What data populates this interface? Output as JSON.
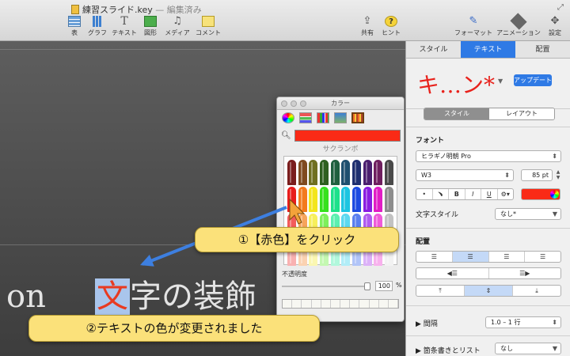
{
  "window": {
    "title": "練習スライド.key",
    "edited": "— 編集済み"
  },
  "toolbar": {
    "left_items": [
      {
        "label": "表",
        "icon": "table-icon"
      },
      {
        "label": "グラフ",
        "icon": "chart-icon"
      },
      {
        "label": "テキスト",
        "icon": "text-icon"
      },
      {
        "label": "図形",
        "icon": "shape-icon"
      },
      {
        "label": "メディア",
        "icon": "media-icon"
      },
      {
        "label": "コメント",
        "icon": "comment-icon"
      }
    ],
    "mid_items": [
      {
        "label": "共有",
        "icon": "share-icon"
      },
      {
        "label": "ヒント",
        "icon": "hint-icon"
      }
    ],
    "right_items": [
      {
        "label": "フォーマット",
        "icon": "format-icon"
      },
      {
        "label": "アニメーション",
        "icon": "animation-icon"
      },
      {
        "label": "設定",
        "icon": "settings-icon"
      }
    ]
  },
  "slide": {
    "word1": "on",
    "selected_char": "文",
    "rest": "字の装飾"
  },
  "colors_panel": {
    "title": "カラー",
    "current_color": "#fa2a16",
    "color_name": "サクランボ",
    "opacity_label": "不透明度",
    "opacity_value": "100",
    "opacity_unit": "%",
    "crayon_rows": [
      [
        "#7a1d1d",
        "#7f4a1f",
        "#6f6f21",
        "#2e5f1f",
        "#1f5f3f",
        "#1f4f6f",
        "#1f2f6f",
        "#4a1f6f",
        "#6f1f5f",
        "#4a4a4a"
      ],
      [
        "#e81c1c",
        "#f37a1d",
        "#f3e51d",
        "#36e11d",
        "#1de18a",
        "#1dc5e1",
        "#1d4ae1",
        "#8a1de1",
        "#e11dc5",
        "#8d8d8d"
      ],
      [
        "#f35b5b",
        "#f7a45b",
        "#f7ef5b",
        "#7ef05b",
        "#5bf0b0",
        "#5bd9f0",
        "#5b7ff0",
        "#b05bf0",
        "#f05bd9",
        "#c2c2c2"
      ],
      [
        "#f9b1b1",
        "#fbd2b1",
        "#fbf7b1",
        "#c4f8b1",
        "#b1f8dc",
        "#b1edf8",
        "#b1c4f8",
        "#dcb1f8",
        "#f8b1ed",
        "#f2f2f2"
      ]
    ]
  },
  "inspector": {
    "tabs": [
      "スタイル",
      "テキスト",
      "配置"
    ],
    "style_name": "キ…ン*",
    "update_label": "アップデート",
    "sub_tabs": [
      "スタイル",
      "レイアウト"
    ],
    "font_label": "フォント",
    "font_family": "ヒラギノ明朝 Pro",
    "font_weight": "W3",
    "font_size": "85 pt",
    "format_buttons": [
      "•",
      "﹅",
      "B",
      "I",
      "U",
      "⚙▾"
    ],
    "text_color": "#fa2a16",
    "char_style_label": "文字スタイル",
    "char_style_value": "なし*",
    "alignment_label": "配置",
    "spacing_label": "間隔",
    "spacing_value": "1.0 – 1 行",
    "bullets_label": "箇条書きとリスト",
    "bullets_value": "なし"
  },
  "annotations": {
    "step1": "①【赤色】をクリック",
    "step2": "②テキストの色が変更されました"
  },
  "colors": {
    "accent": "#2f7ae5",
    "callout": "#fbe17a",
    "arrow": "#3d7fe0",
    "red": "#e8221c"
  }
}
